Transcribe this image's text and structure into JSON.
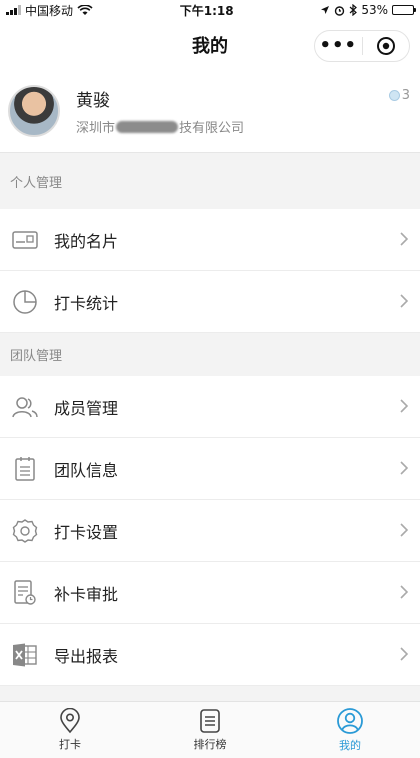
{
  "status_bar": {
    "carrier": "中国移动",
    "time": "下午1:18",
    "battery": "53%",
    "battery_level": 0.53
  },
  "nav": {
    "title": "我的",
    "more_icon": "more-dots-icon",
    "capsule_icon": "target-circle-icon"
  },
  "profile": {
    "name": "黄骏",
    "company_prefix": "深圳市",
    "company_suffix": "技有限公司",
    "points": "3",
    "points_icon": "coin-icon"
  },
  "sections": [
    {
      "title": "个人管理",
      "items": [
        {
          "label": "我的名片",
          "icon": "id-card-icon"
        },
        {
          "label": "打卡统计",
          "icon": "pie-chart-icon"
        }
      ]
    },
    {
      "title": "团队管理",
      "items": [
        {
          "label": "成员管理",
          "icon": "members-icon"
        },
        {
          "label": "团队信息",
          "icon": "clipboard-icon"
        },
        {
          "label": "打卡设置",
          "icon": "gear-icon"
        },
        {
          "label": "补卡审批",
          "icon": "approval-doc-icon"
        },
        {
          "label": "导出报表",
          "icon": "excel-icon"
        }
      ]
    }
  ],
  "tab_bar": {
    "active_color": "#2a9ad6",
    "tabs": [
      {
        "label": "打卡",
        "icon": "location-pin-icon",
        "active": false
      },
      {
        "label": "排行榜",
        "icon": "list-board-icon",
        "active": false
      },
      {
        "label": "我的",
        "icon": "user-circle-icon",
        "active": true
      }
    ]
  }
}
